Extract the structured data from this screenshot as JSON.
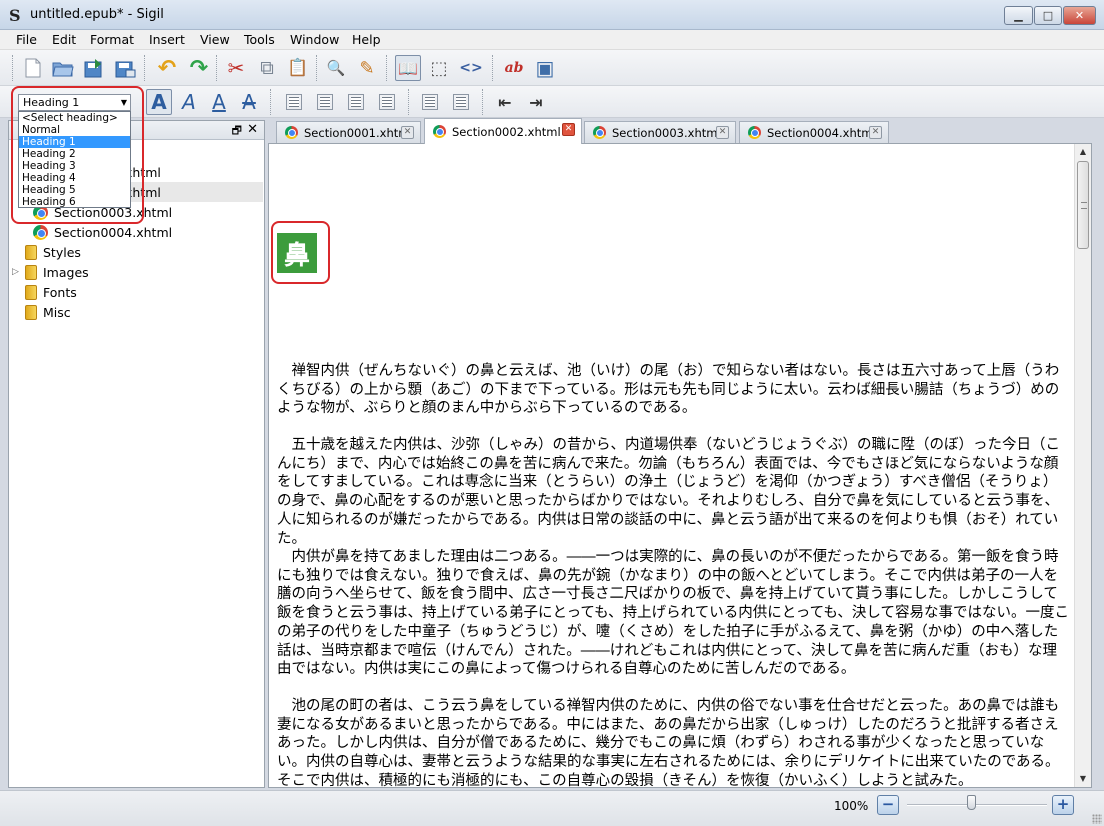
{
  "window": {
    "title": "untitled.epub* - Sigil",
    "app_icon_glyph": "S",
    "minimize_glyph": "▁",
    "maximize_glyph": "□",
    "close_glyph": "✕"
  },
  "menu": [
    "File",
    "Edit",
    "Format",
    "Insert",
    "View",
    "Tools",
    "Window",
    "Help"
  ],
  "toolbar_main": {
    "icons": [
      "new-file-icon",
      "open-folder-icon",
      "save-icon",
      "save-as-icon",
      "undo-icon",
      "redo-icon",
      "cut-icon",
      "copy-icon",
      "paste-icon",
      "find-icon",
      "find-replace-icon",
      "book-view-icon",
      "split-view-icon",
      "code-view-icon",
      "spellcheck-icon",
      "image-icon"
    ],
    "glyphs": {
      "undo": "↶",
      "redo": "↷",
      "cut": "✂",
      "copy": "⧉",
      "paste": "📋",
      "find": "🔍",
      "replace": "✎",
      "book_view": "📖",
      "split_view": "⬚",
      "code_view": "<>",
      "spellcheck": "ab",
      "image": "▣"
    }
  },
  "toolbar_format": {
    "heading_combo_value": "Heading 1",
    "heading_options": [
      "<Select heading>",
      "Normal",
      "Heading 1",
      "Heading 2",
      "Heading 3",
      "Heading 4",
      "Heading 5",
      "Heading 6"
    ],
    "heading_selected_index": 2,
    "glyphs": {
      "bold": "A",
      "italic": "A",
      "underline": "A",
      "strike": "A",
      "outdent": "⇤",
      "indent": "⇥"
    },
    "icons": [
      "bold-icon",
      "italic-icon",
      "underline-icon",
      "strikethrough-icon",
      "align-left-icon",
      "align-center-icon",
      "align-right-icon",
      "justify-icon",
      "bullet-list-icon",
      "numbered-list-icon",
      "decrease-indent-icon",
      "increase-indent-icon"
    ]
  },
  "book_browser": {
    "float_glyph": "🗗",
    "close_glyph": "✕",
    "items": [
      {
        "label": "xhtml",
        "type": "file"
      },
      {
        "label": "xhtml",
        "type": "file"
      },
      {
        "label": "Section0003.xhtml",
        "type": "file"
      },
      {
        "label": "Section0004.xhtml",
        "type": "file"
      },
      {
        "label": "Styles",
        "type": "folder"
      },
      {
        "label": "Images",
        "type": "folder"
      },
      {
        "label": "Fonts",
        "type": "folder"
      },
      {
        "label": "Misc",
        "type": "folder"
      }
    ]
  },
  "tabs": [
    {
      "label": "Section0001.xhtml",
      "active": false
    },
    {
      "label": "Section0002.xhtml",
      "active": true
    },
    {
      "label": "Section0003.xhtml",
      "active": false
    },
    {
      "label": "Section0004.xhtml",
      "active": false
    }
  ],
  "editor": {
    "heading_char": "鼻",
    "heading_color": "#3c9c3c",
    "paragraphs": [
      "禅智内供（ぜんちないぐ）の鼻と云えば、池（いけ）の尾（お）で知らない者はない。長さは五六寸あって上唇（うわくちびる）の上から顋（あご）の下まで下っている。形は元も先も同じように太い。云わば細長い腸詰（ちょうづ）めのような物が、ぶらりと顔のまん中からぶら下っているのである。",
      "五十歳を越えた内供は、沙弥（しゃみ）の昔から、内道場供奉（ないどうじょうぐぶ）の職に陞（のぼ）った今日（こんにち）まで、内心では始終この鼻を苦に病んで来た。勿論（もちろん）表面では、今でもさほど気にならないような顔をしてすましている。これは専念に当来（とうらい）の浄土（じょうど）を渇仰（かつぎょう）すべき僧侶（そうりょ）の身で、鼻の心配をするのが悪いと思ったからばかりではない。それよりむしろ、自分で鼻を気にしていると云う事を、人に知られるのが嫌だったからである。内供は日常の談話の中に、鼻と云う語が出て来るのを何よりも惧（おそ）れていた。",
      "内供が鼻を持てあました理由は二つある。――一つは実際的に、鼻の長いのが不便だったからである。第一飯を食う時にも独りでは食えない。独りで食えば、鼻の先が鋺（かなまり）の中の飯へとどいてしまう。そこで内供は弟子の一人を膳の向うへ坐らせて、飯を食う間中、広さ一寸長さ二尺ばかりの板で、鼻を持上げていて貰う事にした。しかしこうして飯を食うと云う事は、持上げている弟子にとっても、持上げられている内供にとっても、決して容易な事ではない。一度この弟子の代りをした中童子（ちゅうどうじ）が、嚔（くさめ）をした拍子に手がふるえて、鼻を粥（かゆ）の中へ落した話は、当時京都まで喧伝（けんでん）された。――けれどもこれは内供にとって、決して鼻を苦に病んだ重（おも）な理由ではない。内供は実にこの鼻によって傷つけられる自尊心のために苦しんだのである。",
      "池の尾の町の者は、こう云う鼻をしている禅智内供のために、内供の俗でない事を仕合せだと云った。あの鼻では誰も妻になる女があるまいと思ったからである。中にはまた、あの鼻だから出家（しゅっけ）したのだろうと批評する者さえあった。しかし内供は、自分が僧であるために、幾分でもこの鼻に煩（わずら）わされる事が少くなったと思っていない。内供の自尊心は、妻帯と云うような結果的な事実に左右されるためには、余りにデリケイトに出来ていたのである。そこで内供は、積極的にも消極的にも、この自尊心の毀損（きそん）を恢復（かいふく）しようと試みた。"
    ],
    "scroll_up_glyph": "▲",
    "scroll_down_glyph": "▼"
  },
  "status": {
    "zoom": "100%",
    "zoom_out_glyph": "−",
    "zoom_in_glyph": "+"
  },
  "colors": {
    "highlight": "#d9282b",
    "selection": "#3399ff"
  }
}
